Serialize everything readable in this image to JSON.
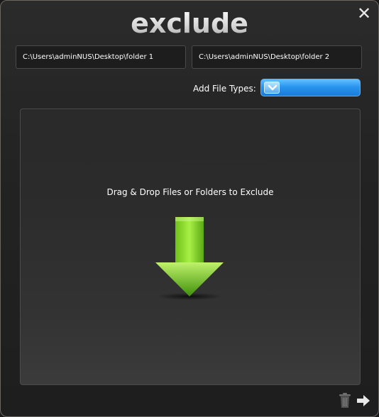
{
  "app": {
    "title": "exclude"
  },
  "paths": {
    "source": "C:\\Users\\adminNUS\\Desktop\\folder 1",
    "target": "C:\\Users\\adminNUS\\Desktop\\folder 2"
  },
  "filetypes": {
    "label": "Add File Types:",
    "selected": ""
  },
  "dropzone": {
    "text": "Drag & Drop Files or Folders to Exclude"
  },
  "icons": {
    "close": "close-icon",
    "dropdown": "chevron-down-icon",
    "drop_arrow": "down-arrow-icon",
    "trash": "trash-icon",
    "next": "arrow-right-icon"
  },
  "colors": {
    "accent_blue": "#2a95ee",
    "arrow_green": "#7fd21a",
    "window_bg": "#232323"
  }
}
